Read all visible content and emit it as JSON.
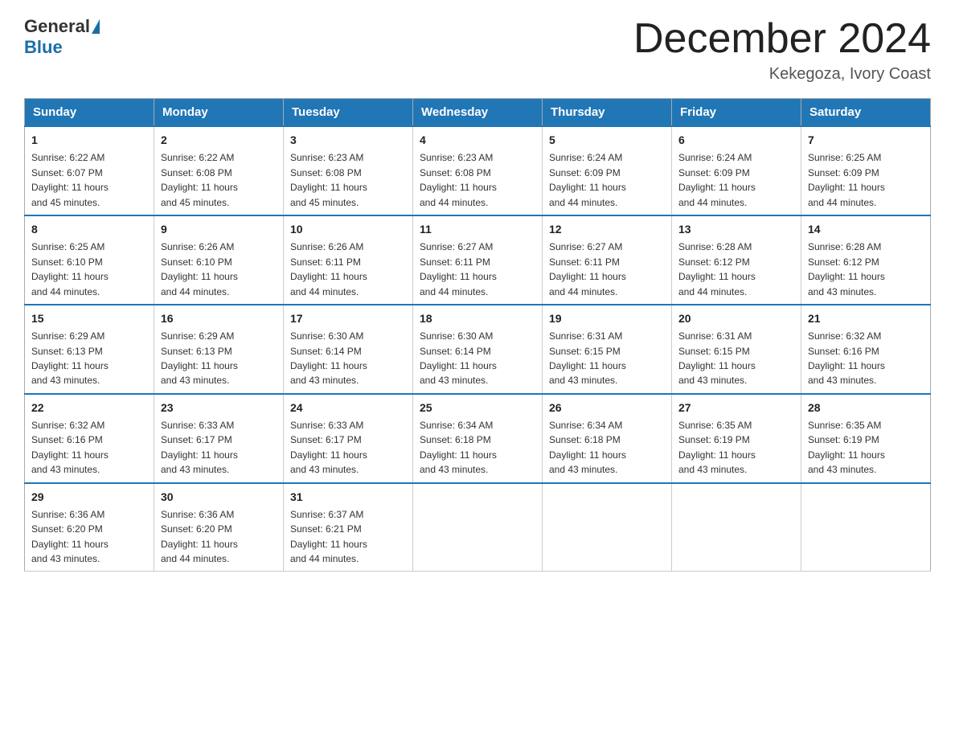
{
  "header": {
    "logo": {
      "general": "General",
      "blue": "Blue"
    },
    "title": "December 2024",
    "location": "Kekegoza, Ivory Coast"
  },
  "weekdays": [
    "Sunday",
    "Monday",
    "Tuesday",
    "Wednesday",
    "Thursday",
    "Friday",
    "Saturday"
  ],
  "weeks": [
    [
      {
        "day": "1",
        "sunrise": "6:22 AM",
        "sunset": "6:07 PM",
        "daylight": "11 hours and 45 minutes."
      },
      {
        "day": "2",
        "sunrise": "6:22 AM",
        "sunset": "6:08 PM",
        "daylight": "11 hours and 45 minutes."
      },
      {
        "day": "3",
        "sunrise": "6:23 AM",
        "sunset": "6:08 PM",
        "daylight": "11 hours and 45 minutes."
      },
      {
        "day": "4",
        "sunrise": "6:23 AM",
        "sunset": "6:08 PM",
        "daylight": "11 hours and 44 minutes."
      },
      {
        "day": "5",
        "sunrise": "6:24 AM",
        "sunset": "6:09 PM",
        "daylight": "11 hours and 44 minutes."
      },
      {
        "day": "6",
        "sunrise": "6:24 AM",
        "sunset": "6:09 PM",
        "daylight": "11 hours and 44 minutes."
      },
      {
        "day": "7",
        "sunrise": "6:25 AM",
        "sunset": "6:09 PM",
        "daylight": "11 hours and 44 minutes."
      }
    ],
    [
      {
        "day": "8",
        "sunrise": "6:25 AM",
        "sunset": "6:10 PM",
        "daylight": "11 hours and 44 minutes."
      },
      {
        "day": "9",
        "sunrise": "6:26 AM",
        "sunset": "6:10 PM",
        "daylight": "11 hours and 44 minutes."
      },
      {
        "day": "10",
        "sunrise": "6:26 AM",
        "sunset": "6:11 PM",
        "daylight": "11 hours and 44 minutes."
      },
      {
        "day": "11",
        "sunrise": "6:27 AM",
        "sunset": "6:11 PM",
        "daylight": "11 hours and 44 minutes."
      },
      {
        "day": "12",
        "sunrise": "6:27 AM",
        "sunset": "6:11 PM",
        "daylight": "11 hours and 44 minutes."
      },
      {
        "day": "13",
        "sunrise": "6:28 AM",
        "sunset": "6:12 PM",
        "daylight": "11 hours and 44 minutes."
      },
      {
        "day": "14",
        "sunrise": "6:28 AM",
        "sunset": "6:12 PM",
        "daylight": "11 hours and 43 minutes."
      }
    ],
    [
      {
        "day": "15",
        "sunrise": "6:29 AM",
        "sunset": "6:13 PM",
        "daylight": "11 hours and 43 minutes."
      },
      {
        "day": "16",
        "sunrise": "6:29 AM",
        "sunset": "6:13 PM",
        "daylight": "11 hours and 43 minutes."
      },
      {
        "day": "17",
        "sunrise": "6:30 AM",
        "sunset": "6:14 PM",
        "daylight": "11 hours and 43 minutes."
      },
      {
        "day": "18",
        "sunrise": "6:30 AM",
        "sunset": "6:14 PM",
        "daylight": "11 hours and 43 minutes."
      },
      {
        "day": "19",
        "sunrise": "6:31 AM",
        "sunset": "6:15 PM",
        "daylight": "11 hours and 43 minutes."
      },
      {
        "day": "20",
        "sunrise": "6:31 AM",
        "sunset": "6:15 PM",
        "daylight": "11 hours and 43 minutes."
      },
      {
        "day": "21",
        "sunrise": "6:32 AM",
        "sunset": "6:16 PM",
        "daylight": "11 hours and 43 minutes."
      }
    ],
    [
      {
        "day": "22",
        "sunrise": "6:32 AM",
        "sunset": "6:16 PM",
        "daylight": "11 hours and 43 minutes."
      },
      {
        "day": "23",
        "sunrise": "6:33 AM",
        "sunset": "6:17 PM",
        "daylight": "11 hours and 43 minutes."
      },
      {
        "day": "24",
        "sunrise": "6:33 AM",
        "sunset": "6:17 PM",
        "daylight": "11 hours and 43 minutes."
      },
      {
        "day": "25",
        "sunrise": "6:34 AM",
        "sunset": "6:18 PM",
        "daylight": "11 hours and 43 minutes."
      },
      {
        "day": "26",
        "sunrise": "6:34 AM",
        "sunset": "6:18 PM",
        "daylight": "11 hours and 43 minutes."
      },
      {
        "day": "27",
        "sunrise": "6:35 AM",
        "sunset": "6:19 PM",
        "daylight": "11 hours and 43 minutes."
      },
      {
        "day": "28",
        "sunrise": "6:35 AM",
        "sunset": "6:19 PM",
        "daylight": "11 hours and 43 minutes."
      }
    ],
    [
      {
        "day": "29",
        "sunrise": "6:36 AM",
        "sunset": "6:20 PM",
        "daylight": "11 hours and 43 minutes."
      },
      {
        "day": "30",
        "sunrise": "6:36 AM",
        "sunset": "6:20 PM",
        "daylight": "11 hours and 44 minutes."
      },
      {
        "day": "31",
        "sunrise": "6:37 AM",
        "sunset": "6:21 PM",
        "daylight": "11 hours and 44 minutes."
      },
      null,
      null,
      null,
      null
    ]
  ],
  "labels": {
    "sunrise": "Sunrise:",
    "sunset": "Sunset:",
    "daylight": "Daylight:"
  }
}
